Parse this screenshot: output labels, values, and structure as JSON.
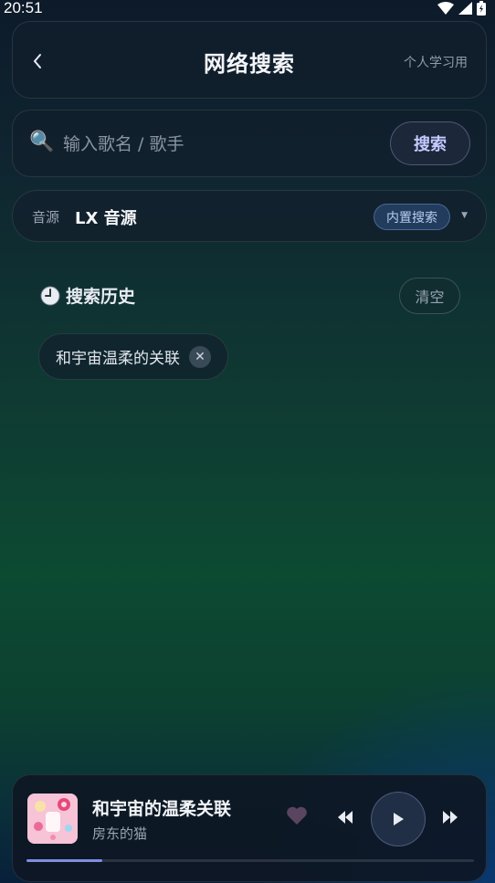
{
  "status_bar": {
    "time": "20:51"
  },
  "header": {
    "title": "网络搜索",
    "note": "个人学习用"
  },
  "search": {
    "placeholder": "输入歌名 / 歌手",
    "value": "",
    "button_label": "搜索"
  },
  "source": {
    "label": "音源",
    "name": "LX 音源",
    "badge": "内置搜索"
  },
  "history": {
    "title": "搜索历史",
    "clear_label": "清空",
    "items": [
      "和宇宙温柔的关联"
    ]
  },
  "player": {
    "title": "和宇宙的温柔关联",
    "artist": "房东的猫",
    "progress_fraction": 0.17,
    "liked": false
  },
  "colors": {
    "accent": "#7f8fe0",
    "search_button_text": "#c4cbff",
    "badge_text": "#b9cdf0",
    "heart": "#5a4560"
  },
  "icons": [
    "back-chevron-icon",
    "search-icon",
    "dropdown-arrow-icon",
    "clock-icon",
    "close-icon",
    "heart-icon",
    "previous-icon",
    "play-icon",
    "next-icon",
    "wifi-icon",
    "signal-icon",
    "battery-icon"
  ]
}
